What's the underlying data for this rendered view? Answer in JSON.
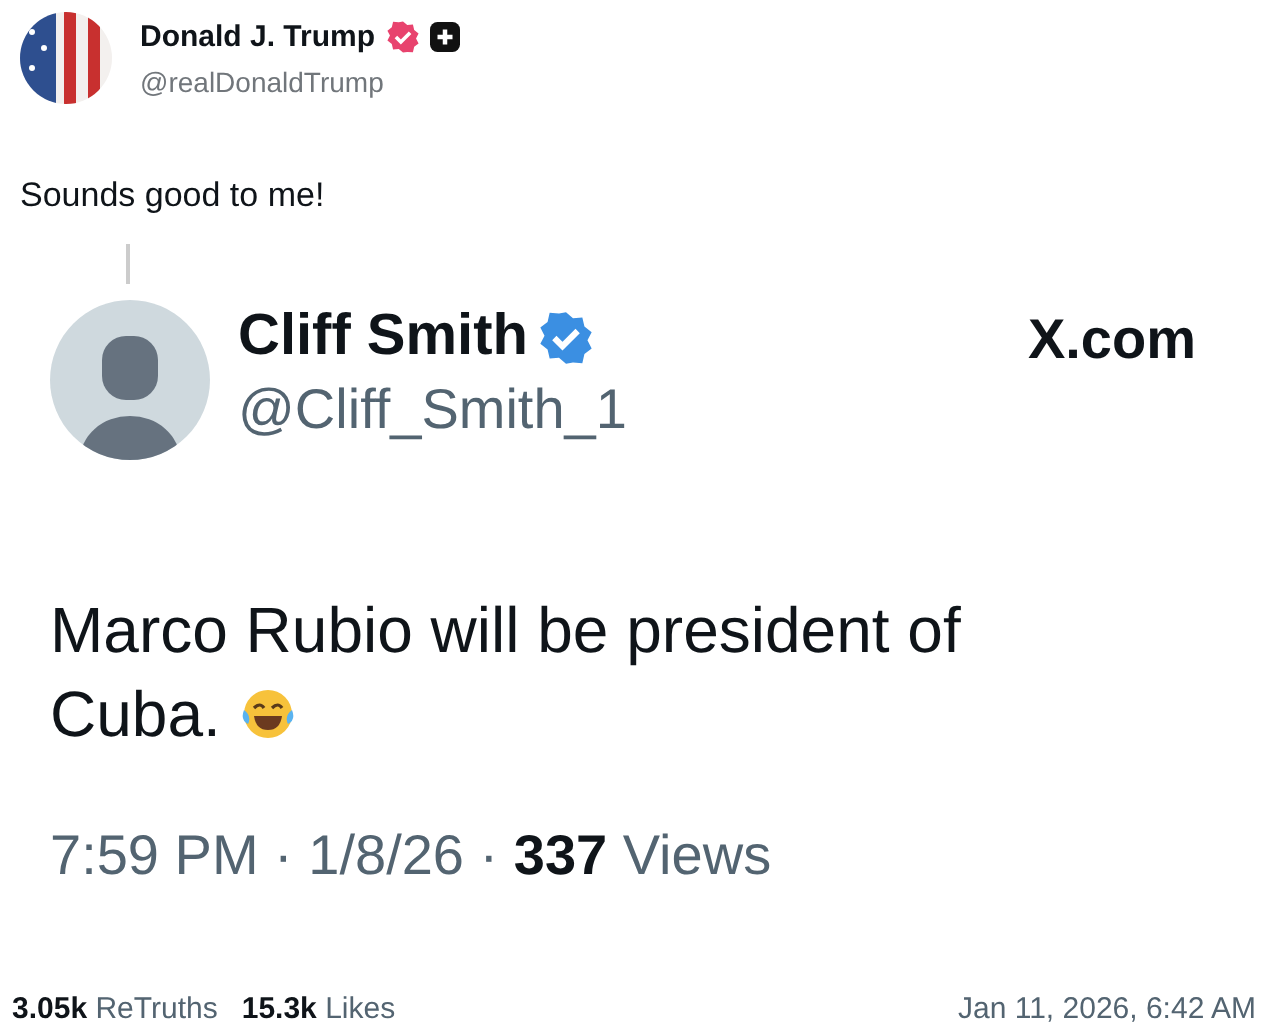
{
  "author": {
    "name": "Donald J. Trump",
    "handle": "@realDonaldTrump",
    "verified": true,
    "plus_badge": true
  },
  "post_text": "Sounds good to me!",
  "quoted": {
    "name": "Cliff Smith",
    "handle": "@Cliff_Smith_1",
    "verified": true,
    "source": "X.com",
    "text_lines": [
      "Marco Rubio will be president of",
      "Cuba."
    ],
    "meta": "7:59 PM · 1/8/26 · **337** Views"
  },
  "stats": [
    {
      "count": "3.05k",
      "label": "ReTruths"
    },
    {
      "count": "15.3k",
      "label": "Likes"
    }
  ],
  "timestamp": "Jan 11, 2026, 6:42 AM"
}
